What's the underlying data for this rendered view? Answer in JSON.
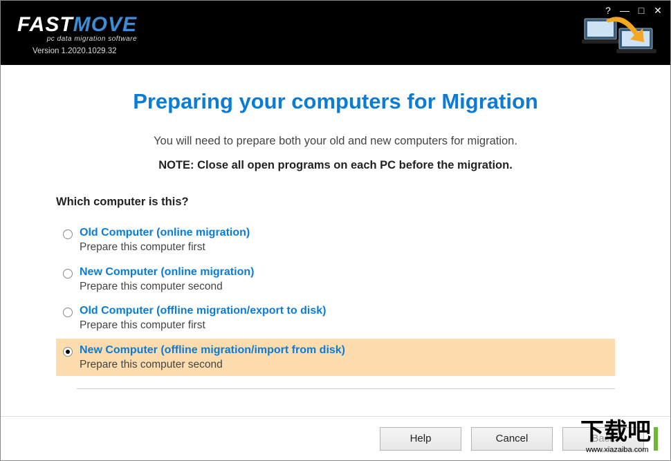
{
  "app": {
    "brand_main": "FAST",
    "brand_accent": "MOVE",
    "tagline": "pc data migration software",
    "version": "Version 1.2020.1029.32"
  },
  "titlebar": {
    "help": "?",
    "min": "—",
    "max": "□",
    "close": "✕"
  },
  "page": {
    "heading": "Preparing your computers for Migration",
    "subtitle": "You will need to prepare both your old and new computers for migration.",
    "note": "NOTE: Close all open programs on each PC before the migration.",
    "question": "Which computer is this?"
  },
  "options": [
    {
      "title": "Old Computer (online migration)",
      "desc": "Prepare this computer first",
      "selected": false
    },
    {
      "title": "New Computer (online migration)",
      "desc": "Prepare this computer second",
      "selected": false
    },
    {
      "title": "Old Computer (offline migration/export to disk)",
      "desc": "Prepare this computer first",
      "selected": false
    },
    {
      "title": "New Computer (offline migration/import from disk)",
      "desc": "Prepare this computer second",
      "selected": true
    }
  ],
  "footer": {
    "help": "Help",
    "cancel": "Cancel",
    "back": "Back"
  },
  "watermark": {
    "text": "下载吧",
    "url": "www.xiazaiba.com"
  },
  "colors": {
    "accent_blue": "#0b7cd6",
    "highlight": "#fddcae",
    "green": "#6db833"
  }
}
